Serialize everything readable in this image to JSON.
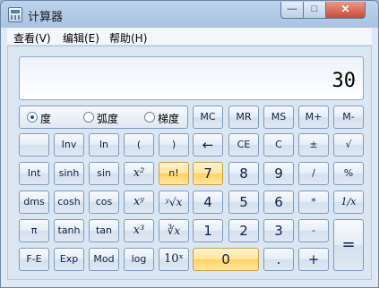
{
  "window": {
    "title": "计算器",
    "minimize_glyph": "—",
    "maximize_glyph": "□",
    "close_glyph": "✕"
  },
  "menu": [
    "查看(V)",
    "编辑(E)",
    "帮助(H)"
  ],
  "display": {
    "value": "30"
  },
  "angle_mode": {
    "options": [
      "度",
      "弧度",
      "梯度"
    ],
    "selected": "度"
  },
  "memory_buttons": [
    "MC",
    "MR",
    "MS",
    "M+",
    "M-"
  ],
  "rows": [
    [
      "",
      "Inv",
      "ln",
      "(",
      ")",
      "←",
      "CE",
      "C",
      "±",
      "√"
    ],
    [
      "Int",
      "sinh",
      "sin",
      "x²",
      "n!",
      "7",
      "8",
      "9",
      "/",
      "%"
    ],
    [
      "dms",
      "cosh",
      "cos",
      "xʸ",
      "ʸ√x",
      "4",
      "5",
      "6",
      "*",
      "1/x"
    ],
    [
      "π",
      "tanh",
      "tan",
      "x³",
      "∛x",
      "1",
      "2",
      "3",
      "-",
      "="
    ],
    [
      "F-E",
      "Exp",
      "Mod",
      "log",
      "10ˣ",
      "0",
      ".",
      "+"
    ]
  ]
}
